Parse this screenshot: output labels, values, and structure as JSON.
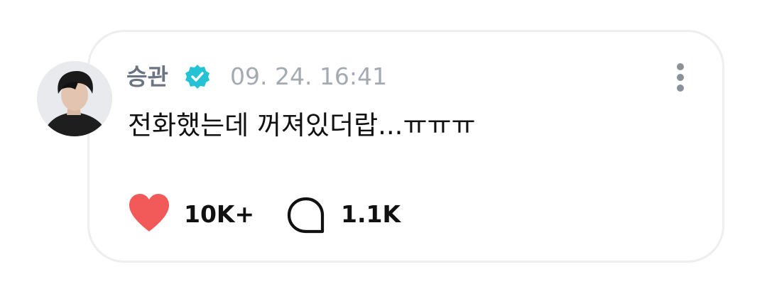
{
  "post": {
    "author": "승관",
    "verified_icon": "verified-badge-icon",
    "timestamp": "09. 24. 16:41",
    "text": "전화했는데 꺼져있더랍...ㅠㅠㅠ",
    "likes": "10K+",
    "comments": "1.1K"
  },
  "icons": {
    "like": "heart-icon",
    "comment": "comment-bubble-icon",
    "more": "more-options-icon"
  },
  "colors": {
    "heart": "#f25a5a",
    "verified": "#25c2d6",
    "author": "#6b7482",
    "timestamp": "#a4aab2",
    "card_border": "#eceef0"
  }
}
